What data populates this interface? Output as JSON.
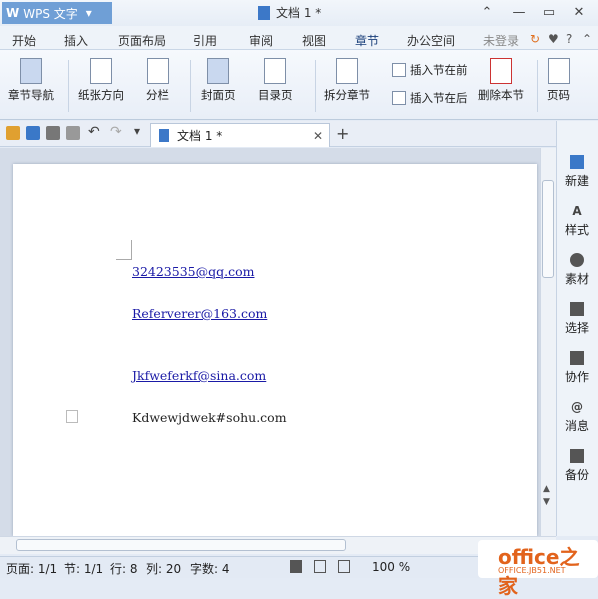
{
  "app": {
    "logo_text": "WPS 文字",
    "dropdown": "▾"
  },
  "window": {
    "title": "文档 1 *"
  },
  "menu": {
    "items": [
      "开始",
      "插入",
      "页面布局",
      "引用",
      "审阅",
      "视图",
      "章节",
      "办公空间"
    ],
    "active": "章节",
    "login": "未登录"
  },
  "ribbon": {
    "nav": "章节导航",
    "orientation": "纸张方向",
    "columns": "分栏",
    "cover": "封面页",
    "toc": "目录页",
    "split": "拆分章节",
    "insert_before": "插入节在前",
    "insert_after": "插入节在后",
    "delete": "删除本节",
    "pagenum": "页码"
  },
  "tab": {
    "label": "文档 1 *"
  },
  "document": {
    "lines": [
      "32423535@qq.com",
      "Referverer@163.com",
      "Jkfweferkf@sina.com",
      "Kdwewjdwek#sohu.com"
    ]
  },
  "side_panel": [
    "新建",
    "样式",
    "素材",
    "选择",
    "协作",
    "消息",
    "备份"
  ],
  "status": {
    "page": "页面: 1/1",
    "section": "节: 1/1",
    "row": "行: 8",
    "col": "列: 20",
    "words": "字数: 4",
    "zoom": "100 %"
  },
  "watermark": {
    "text": "office之家",
    "url": "OFFICE.JB51.NET"
  },
  "colors": {
    "accent": "#2f7fd6",
    "link": "#1a1aa6"
  }
}
